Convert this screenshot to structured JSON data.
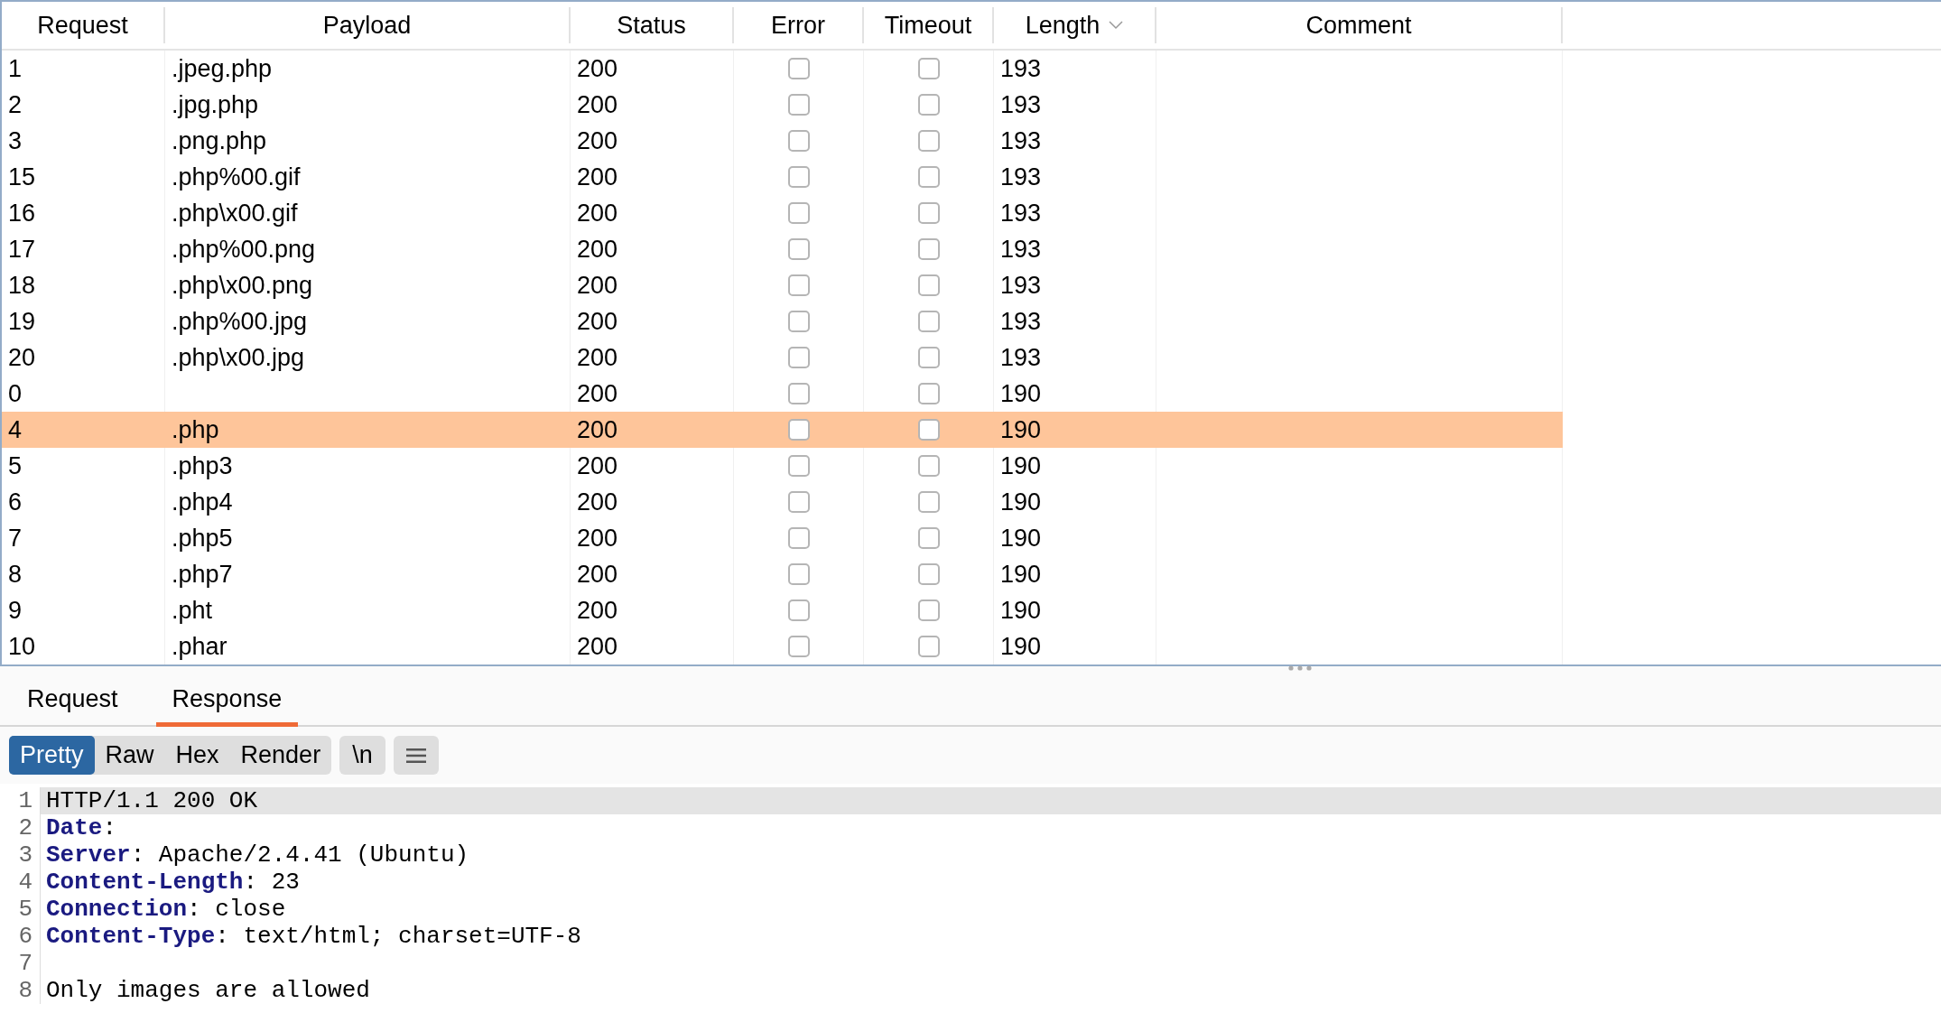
{
  "results_table": {
    "columns": [
      {
        "label": "Request",
        "sorted": false
      },
      {
        "label": "Payload",
        "sorted": false
      },
      {
        "label": "Status",
        "sorted": false
      },
      {
        "label": "Error",
        "sorted": false
      },
      {
        "label": "Timeout",
        "sorted": false
      },
      {
        "label": "Length",
        "sorted": true
      },
      {
        "label": "Comment",
        "sorted": false
      }
    ],
    "rows": [
      {
        "request": "1",
        "payload": ".jpeg.php",
        "status": "200",
        "error": false,
        "timeout": false,
        "length": "193",
        "selected": false
      },
      {
        "request": "2",
        "payload": ".jpg.php",
        "status": "200",
        "error": false,
        "timeout": false,
        "length": "193",
        "selected": false
      },
      {
        "request": "3",
        "payload": ".png.php",
        "status": "200",
        "error": false,
        "timeout": false,
        "length": "193",
        "selected": false
      },
      {
        "request": "15",
        "payload": ".php%00.gif",
        "status": "200",
        "error": false,
        "timeout": false,
        "length": "193",
        "selected": false
      },
      {
        "request": "16",
        "payload": ".php\\x00.gif",
        "status": "200",
        "error": false,
        "timeout": false,
        "length": "193",
        "selected": false
      },
      {
        "request": "17",
        "payload": ".php%00.png",
        "status": "200",
        "error": false,
        "timeout": false,
        "length": "193",
        "selected": false
      },
      {
        "request": "18",
        "payload": ".php\\x00.png",
        "status": "200",
        "error": false,
        "timeout": false,
        "length": "193",
        "selected": false
      },
      {
        "request": "19",
        "payload": ".php%00.jpg",
        "status": "200",
        "error": false,
        "timeout": false,
        "length": "193",
        "selected": false
      },
      {
        "request": "20",
        "payload": ".php\\x00.jpg",
        "status": "200",
        "error": false,
        "timeout": false,
        "length": "193",
        "selected": false
      },
      {
        "request": "0",
        "payload": "",
        "status": "200",
        "error": false,
        "timeout": false,
        "length": "190",
        "selected": false
      },
      {
        "request": "4",
        "payload": ".php",
        "status": "200",
        "error": false,
        "timeout": false,
        "length": "190",
        "selected": true
      },
      {
        "request": "5",
        "payload": ".php3",
        "status": "200",
        "error": false,
        "timeout": false,
        "length": "190",
        "selected": false
      },
      {
        "request": "6",
        "payload": ".php4",
        "status": "200",
        "error": false,
        "timeout": false,
        "length": "190",
        "selected": false
      },
      {
        "request": "7",
        "payload": ".php5",
        "status": "200",
        "error": false,
        "timeout": false,
        "length": "190",
        "selected": false
      },
      {
        "request": "8",
        "payload": ".php7",
        "status": "200",
        "error": false,
        "timeout": false,
        "length": "190",
        "selected": false
      },
      {
        "request": "9",
        "payload": ".pht",
        "status": "200",
        "error": false,
        "timeout": false,
        "length": "190",
        "selected": false
      },
      {
        "request": "10",
        "payload": ".phar",
        "status": "200",
        "error": false,
        "timeout": false,
        "length": "190",
        "selected": false
      }
    ]
  },
  "tabs": [
    {
      "label": "Request",
      "selected": false
    },
    {
      "label": "Response",
      "selected": true
    }
  ],
  "view_modes": [
    {
      "label": "Pretty",
      "selected": true
    },
    {
      "label": "Raw",
      "selected": false
    },
    {
      "label": "Hex",
      "selected": false
    },
    {
      "label": "Render",
      "selected": false
    }
  ],
  "newline_toggle": "\\n",
  "response_lines": [
    {
      "number": "1",
      "text": "HTTP/1.1 200 OK",
      "selected": true
    },
    {
      "number": "2",
      "text": "**Date**:",
      "selected": false
    },
    {
      "number": "3",
      "text": "**Server**: Apache/2.4.41 (Ubuntu)",
      "selected": false
    },
    {
      "number": "4",
      "text": "**Content-Length**: 23",
      "selected": false
    },
    {
      "number": "5",
      "text": "**Connection**: close",
      "selected": false
    },
    {
      "number": "6",
      "text": "**Content-Type**: text/html; charset=UTF-8",
      "selected": false
    },
    {
      "number": "7",
      "selected": false
    },
    {
      "number": "8",
      "text": "Only images are allowed",
      "selected": false
    }
  ]
}
